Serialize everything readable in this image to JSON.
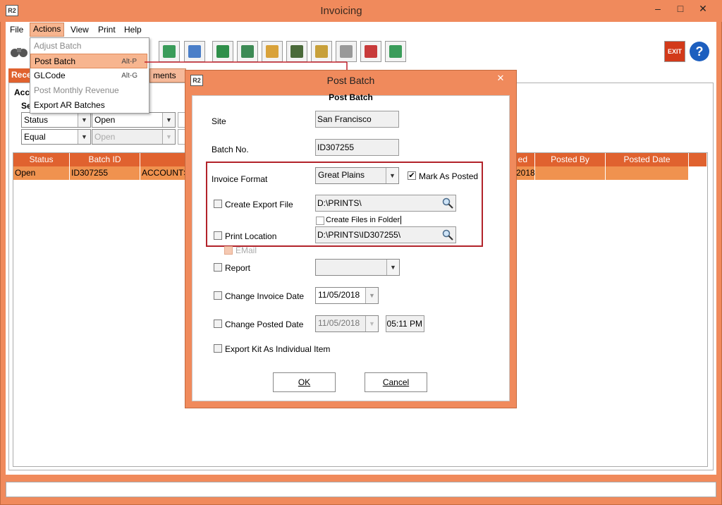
{
  "window": {
    "title": "Invoicing",
    "logo": "R2",
    "minimize": "–",
    "maximize": "□",
    "close": "✕"
  },
  "menubar": [
    "File",
    "Actions",
    "View",
    "Print",
    "Help"
  ],
  "actions_menu": {
    "items": [
      {
        "label": "Adjust Batch",
        "shortcut": "",
        "disabled": true
      },
      {
        "label": "Post Batch",
        "shortcut": "Alt-P",
        "disabled": false
      },
      {
        "label": "GLCode",
        "shortcut": "Alt-G",
        "disabled": false
      },
      {
        "label": "Post Monthly Revenue",
        "shortcut": "",
        "disabled": true
      },
      {
        "label": "Export AR Batches",
        "shortcut": "",
        "disabled": false
      }
    ]
  },
  "toolbar": {
    "exit_label": "EXIT",
    "help_label": "?",
    "icons": [
      "binoculars-icon",
      "search-doc-icon",
      "search-page-icon",
      "invoice-icon",
      "report-icon",
      "users-icon",
      "user-edit-icon",
      "user-coins-icon",
      "puzzle-icon",
      "gift-icon",
      "list-icon"
    ]
  },
  "tabs": {
    "tab1": "Rece",
    "tab2": "ments"
  },
  "filters": {
    "section_label": "Acc",
    "sub_label": "Se",
    "row1": {
      "field": "Status",
      "value": "Open"
    },
    "row2": {
      "operator": "Equal",
      "value": "Open"
    }
  },
  "grid": {
    "headers": [
      "Status",
      "Batch ID",
      "ed",
      "Posted By",
      "Posted Date"
    ],
    "rows": [
      {
        "status": "Open",
        "batch_id": "ID307255",
        "accounts": "ACCOUNTS",
        "posted_frag": "2018",
        "posted_by": "",
        "posted_date": ""
      }
    ]
  },
  "colors": {
    "accent": "#f08a5c",
    "header": "#e0622f",
    "row_selected": "#f0924f",
    "highlight_box": "#b2232a"
  },
  "dialog": {
    "title": "Post Batch",
    "logo": "R2",
    "close": "✕",
    "group_title": "Post Batch",
    "site_label": "Site",
    "site_value": "San Francisco",
    "batch_label": "Batch No.",
    "batch_value": "ID307255",
    "invoice_format_label": "Invoice Format",
    "invoice_format_value": "Great Plains",
    "mark_as_posted_label": "Mark As Posted",
    "mark_as_posted_checked": true,
    "create_export_label": "Create Export File",
    "export_path": "D:\\PRINTS\\",
    "create_files_folder_label": "Create Files in Folder",
    "print_location_label": "Print Location",
    "print_path": "D:\\PRINTS\\ID307255\\",
    "email_label": "EMail",
    "report_label": "Report",
    "report_value": "",
    "change_invoice_date_label": "Change Invoice Date",
    "invoice_date": "11/05/2018",
    "change_posted_date_label": "Change Posted Date",
    "posted_date": "11/05/2018",
    "posted_time": "05:11 PM",
    "export_kit_label": "Export Kit As Individual Item",
    "ok_label": "OK",
    "cancel_label": "Cancel"
  }
}
